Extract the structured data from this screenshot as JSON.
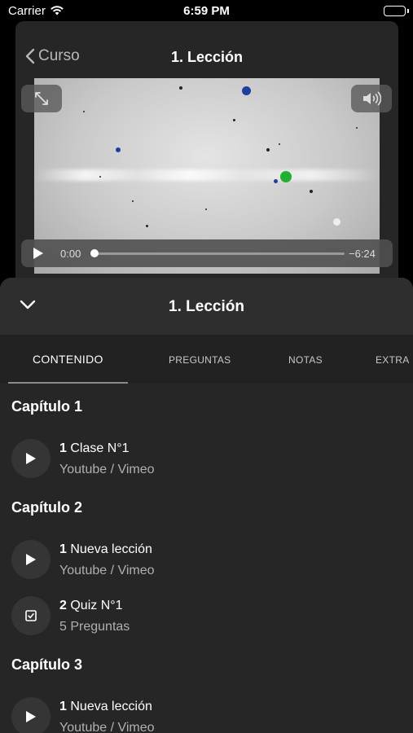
{
  "status_bar": {
    "carrier": "Carrier",
    "time": "6:59 PM"
  },
  "nav": {
    "back_label": "Curso",
    "title": "1. Lección"
  },
  "player": {
    "current_time": "0:00",
    "remaining_time": "−6:24",
    "progress": 0.0
  },
  "sheet": {
    "title": "1. Lección"
  },
  "tabs": [
    {
      "label": "CONTENIDO",
      "active": true
    },
    {
      "label": "PREGUNTAS",
      "active": false
    },
    {
      "label": "NOTAS",
      "active": false
    },
    {
      "label": "EXTRA",
      "active": false
    }
  ],
  "chapters": [
    {
      "title": "Capítulo 1",
      "items": [
        {
          "number": "1",
          "title": "Clase N°1",
          "subtitle": "Youtube / Vimeo",
          "icon": "play-icon"
        }
      ]
    },
    {
      "title": "Capítulo 2",
      "items": [
        {
          "number": "1",
          "title": "Nueva lección",
          "subtitle": "Youtube / Vimeo",
          "icon": "play-icon"
        },
        {
          "number": "2",
          "title": "Quiz N°1",
          "subtitle": "5 Preguntas",
          "icon": "checkbox-icon"
        }
      ]
    },
    {
      "title": "Capítulo 3",
      "items": [
        {
          "number": "1",
          "title": "Nueva lección",
          "subtitle": "Youtube / Vimeo",
          "icon": "play-icon"
        }
      ]
    }
  ]
}
